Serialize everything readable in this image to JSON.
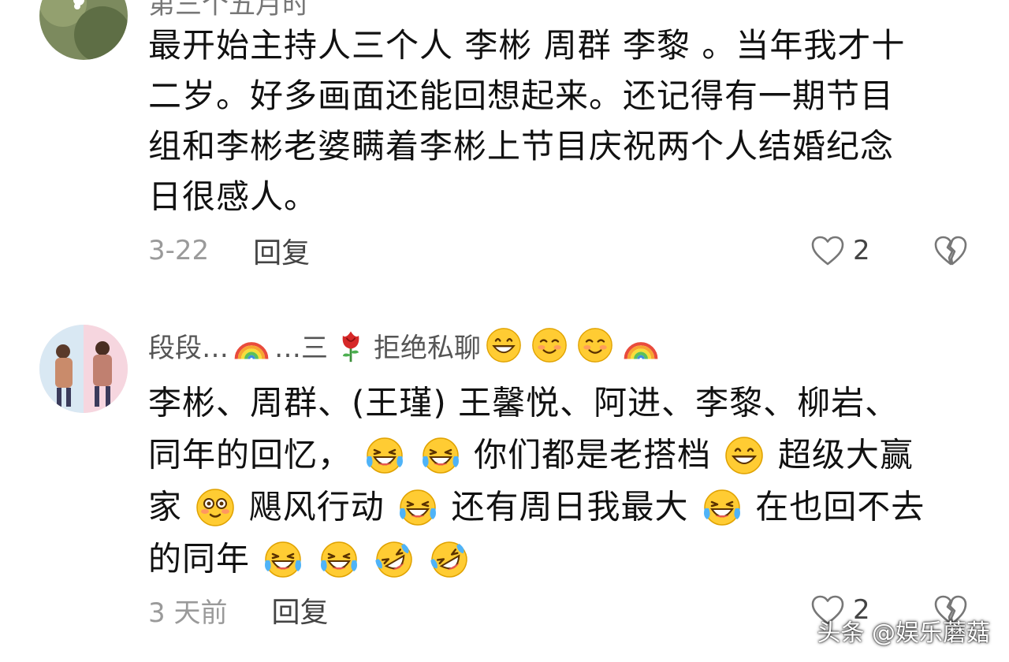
{
  "comments": [
    {
      "username": "第三个五月时",
      "text_lines": [
        "最开始主持人三个人 李彬 周群 李黎 。当年我才十",
        "二岁。好多画面还能回想起来。还记得有一期节目",
        "组和李彬老婆瞒着李彬上节目庆祝两个人结婚纪念",
        "日很感人。"
      ],
      "time": "3-22",
      "reply_label": "回复",
      "like_count": "2"
    },
    {
      "username_parts": {
        "a": "段段…",
        "b": "…三",
        "c": "拒绝私聊"
      },
      "line1_parts": [
        "李彬、周群、(王瑾) 王馨悦、阿进、李黎、柳岩、"
      ],
      "line2_parts": [
        "同年的回忆，",
        "你们都是老搭档",
        "超级大赢"
      ],
      "line3_parts": [
        "家",
        "飓风行动",
        "还有周日我最大",
        "在也回不去"
      ],
      "line4_parts": [
        "的同年"
      ],
      "time": "3 天前",
      "reply_label": "回复",
      "like_count": "2"
    }
  ],
  "watermark": "头条 @娱乐蘑菇",
  "icons": {
    "like": "heart-outline-icon",
    "dislike": "broken-heart-icon",
    "emoji_grin": "grinning-face-emoji",
    "emoji_smile": "smiling-face-emoji",
    "emoji_tears": "face-with-tears-of-joy-emoji",
    "emoji_rofl": "rolling-on-floor-laughing-emoji",
    "emoji_rainbow": "rainbow-emoji",
    "emoji_rose": "rose-emoji",
    "emoji_dizzy": "flushed-face-emoji"
  }
}
